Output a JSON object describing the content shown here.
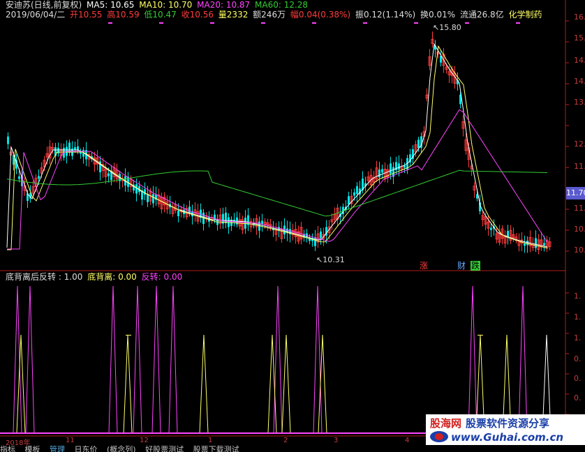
{
  "header": {
    "title": "安迪苏(日线,前复权)",
    "ma5": "MA5: 10.65",
    "ma10": "MA10: 10.70",
    "ma20": "MA20: 10.87",
    "ma60": "MA60: 12.28",
    "date": "2019/06/04/二",
    "open": "开10.55",
    "high": "高10.59",
    "low": "低10.47",
    "close": "收10.56",
    "volume": "量2332",
    "amount": "额246万",
    "change": "幅0.04(0.38%)",
    "amplitude": "振0.12(1.14%)",
    "turnover": "换0.01%",
    "float": "流通26.8亿",
    "sector": "化学制药"
  },
  "indicator": {
    "name": "底背离后反转 : 1.00",
    "divergence": "底背离: 0.00",
    "reversal": "反转: 0.00"
  },
  "price_axis": [
    "16",
    "15",
    "14",
    "13",
    "12",
    "11",
    "11",
    "10"
  ],
  "price_axis_full": [
    "16.",
    "15.",
    "14.",
    "14.",
    "13.",
    "12.",
    "11.",
    "11.",
    "10."
  ],
  "current_price": "11.70",
  "annotations": {
    "high": "15.80",
    "low": "10.31"
  },
  "tags": {
    "zhang": "涨",
    "cai": "财",
    "die": "跌"
  },
  "indicator_axis": [
    "1.",
    "1.",
    "1.",
    "0.",
    "0.",
    "0.",
    "0."
  ],
  "x_axis": [
    "2018年",
    "11",
    "12",
    "1",
    "2",
    "3",
    "4"
  ],
  "tabs": [
    "指标",
    "模板",
    "管理",
    "日东价",
    "(概念列)",
    "好股票测试",
    "股票下载测试"
  ],
  "logo": {
    "name": "股海网",
    "tagline": "股票软件资源分享",
    "url": "www.Guhai.com.cn"
  },
  "colors": {
    "up": "#ff3c3c",
    "down": "#00e5e5",
    "ma5": "#ffffff",
    "ma10": "#ffff66",
    "ma20": "#ff44ff",
    "ma60": "#33cc33",
    "axis": "#b01e1e"
  }
}
